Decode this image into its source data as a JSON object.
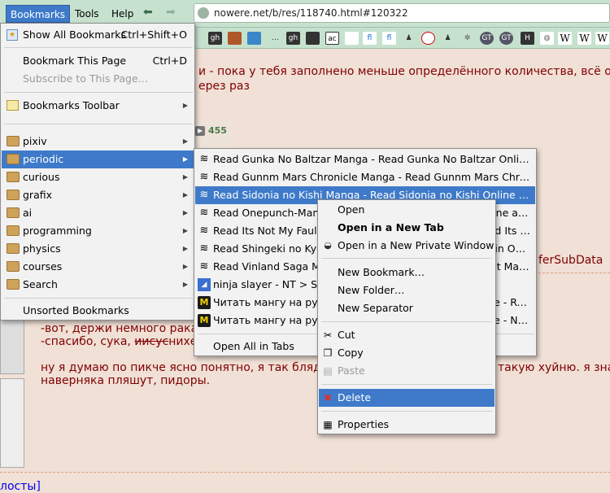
{
  "menubar": {
    "bookmarks": "Bookmarks",
    "tools": "Tools",
    "help": "Help",
    "back": "⬅",
    "forward": "➡",
    "url": "nowere.net/b/res/118740.html#120322"
  },
  "bookmarks_bar_icons": [
    "gh",
    "…",
    "gh",
    "ac",
    "fl",
    "fl",
    "GT",
    "GT",
    "H",
    "W",
    "W",
    "W"
  ],
  "page": {
    "line1": "и - пока у тебя заполнено меньше определённого количества, всё ок,",
    "line2": "ерез раз",
    "count": "455",
    "suffix": "ferSubData",
    "quote1": "-вот, держи немного рака",
    "quote2_prefix": "-спасибо, сука, ",
    "quote2_strike": "иисус",
    "quote2_after": "нихе",
    "reply1": "ну я думаю по пикче ясно понятно, я так блядь",
    "reply1_right": "такую хуйню. я зна",
    "reply2": "наверняка пляшут, пидоры.",
    "bottom": "лосты]"
  },
  "bookmarks_menu": {
    "show_all": "Show All Bookmarks",
    "show_all_shortcut": "Ctrl+Shift+O",
    "bookmark_page": "Bookmark This Page",
    "bookmark_page_shortcut": "Ctrl+D",
    "subscribe": "Subscribe to This Page…",
    "toolbar": "Bookmarks Toolbar",
    "folders": [
      "pixiv",
      "periodic",
      "curious",
      "grafix",
      "ai",
      "programming",
      "physics",
      "courses",
      "Search"
    ],
    "unsorted": "Unsorted Bookmarks"
  },
  "periodic_menu": {
    "items": [
      "Read Gunka No Baltzar Manga - Read Gunka No Baltzar Online ...",
      "Read Gunnm Mars Chronicle Manga - Read Gunnm Mars Chroni...",
      "Read Sidonia no Kishi Manga - Read Sidonia no Kishi Online at ...",
      "Read Onepunch-Man Manga - Read Onepunch-Man Online at M...",
      "Read Its Not My Fault That I'm Not Popular Manga - Read Its No...",
      "Read Shingeki no Kyojin Manga - Read Shingeki no Kyojin Onlin...",
      "Read Vinland Saga Manga - Read Vinland Saga Online at Mang...",
      "ninja slayer - NT > Search",
      "Читать мангу на русском онлайн - Read Manga Online - ReadMa...Tayer...",
      "Читать мангу на русском онлайн - Read Manga Online - Ninja go ..."
    ],
    "open_all": "Open All in Tabs"
  },
  "context_menu": {
    "open": "Open",
    "open_tab": "Open in a New Tab",
    "open_private": "Open in a New Private Window",
    "new_bookmark": "New Bookmark…",
    "new_folder": "New Folder…",
    "new_separator": "New Separator",
    "cut": "Cut",
    "copy": "Copy",
    "paste": "Paste",
    "delete": "Delete",
    "properties": "Properties"
  },
  "colors": {
    "highlight": "#3e7ac9",
    "chrome": "#c6e2cf",
    "page_bg": "#f0e0d6",
    "post_text": "#800000"
  }
}
